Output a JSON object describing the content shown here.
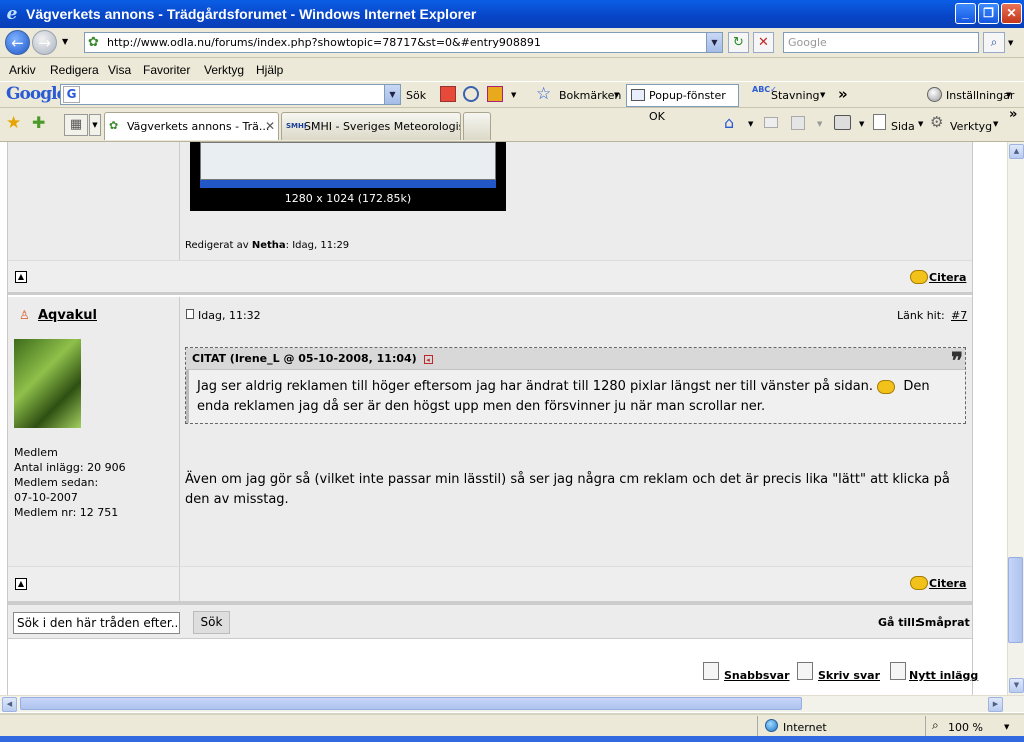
{
  "window": {
    "title": "Vägverkets annons - Trädgårdsforumet - Windows Internet Explorer",
    "controls": [
      "_",
      "❐",
      "✕"
    ]
  },
  "address_bar": {
    "url": "http://www.odla.nu/forums/index.php?showtopic=78717&st=0&#entry908891",
    "search_placeholder": "Google"
  },
  "menu": [
    "Arkiv",
    "Redigera",
    "Visa",
    "Favoriter",
    "Verktyg",
    "Hjälp"
  ],
  "google_toolbar": {
    "logo": "Google",
    "search_label": "Sök",
    "bookmarks": "Bokmärken",
    "popup_blocker": "Popup-fönster OK",
    "spelling": "Stavning",
    "more": "»",
    "settings": "Inställningar"
  },
  "tabs": [
    {
      "label": "Vägverkets annons - Trä...",
      "active": true
    },
    {
      "label": "SMHI - Sveriges Meteorologis...",
      "active": false
    }
  ],
  "command_bar": {
    "page": "Sida",
    "tools": "Verktyg",
    "more": "»"
  },
  "prev_post": {
    "image_caption": "1280 x 1024 (172.85k)",
    "edited_prefix": "Redigerat av",
    "edited_by": "Netha",
    "edited_time": ": Idag, 11:29",
    "quote_btn": "Citera"
  },
  "post": {
    "author": "Aqvakul",
    "date": "Idag, 11:32",
    "link_label": "Länk hit:",
    "link_num": "#7",
    "member_info": [
      "Medlem",
      "Antal inlägg: 20 906",
      "Medlem sedan:",
      "07-10-2007",
      "Medlem nr: 12 751"
    ],
    "quote_header": "CITAT (Irene_L @ 05-10-2008, 11:04)",
    "quote_mark": "99",
    "quote_text_1": "Jag ser aldrig reklamen till höger eftersom jag har ändrat till 1280 pixlar längst ner till vänster på sidan.",
    "quote_text_2": "Den enda reklamen jag då ser är den högst upp men den försvinner ju när man scrollar ner.",
    "body": "Även om jag gör så (vilket inte passar min lässtil) så ser jag några cm reklam och det är precis lika \"lätt\" att klicka på den av misstag.",
    "quote_btn": "Citera"
  },
  "thread_search": {
    "placeholder": "Sök i den här tråden efter...",
    "button": "Sök",
    "goto_label": "Gå till:",
    "goto_target": "Småprat"
  },
  "bottom_links": [
    "Snabbsvar",
    "Skriv svar",
    "Nytt inlägg"
  ],
  "status": {
    "zone": "Internet",
    "zoom": "100 %"
  }
}
